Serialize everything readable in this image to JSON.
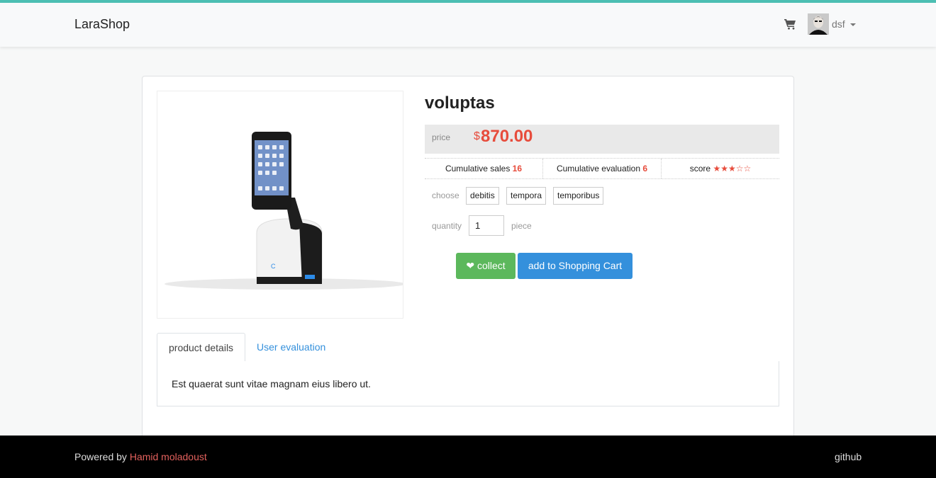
{
  "navbar": {
    "brand": "LaraShop",
    "cart_icon": "shopping-cart-icon",
    "user_name": "dsf"
  },
  "product": {
    "title": "voluptas",
    "price_label": "price",
    "currency_symbol": "$",
    "price": "870.00",
    "sales_label": "Cumulative sales",
    "sales": "16",
    "evaluation_label": "Cumulative evaluation",
    "evaluation": "6",
    "score_label": "score",
    "score_stars": "★★★☆☆",
    "rating": 3,
    "rating_max": 5,
    "choose_label": "choose",
    "skus": [
      "debitis",
      "tempora",
      "temporibus"
    ],
    "quantity_label": "quantity",
    "quantity": "1",
    "piece_label": "piece",
    "collect_label": "❤ collect",
    "add_cart_label": "add to Shopping Cart"
  },
  "tabs": [
    {
      "label": "product details",
      "active": true
    },
    {
      "label": "User evaluation",
      "active": false
    }
  ],
  "description": "Est quaerat sunt vitae magnam eius libero ut.",
  "footer": {
    "powered_prefix": "Powered by ",
    "author": "Hamid moladoust",
    "github": "github"
  },
  "colors": {
    "accent_bar": "#4cbfb3",
    "price_red": "#e74c3c",
    "collect_green": "#5cb85c",
    "cart_blue": "#3490dc"
  }
}
